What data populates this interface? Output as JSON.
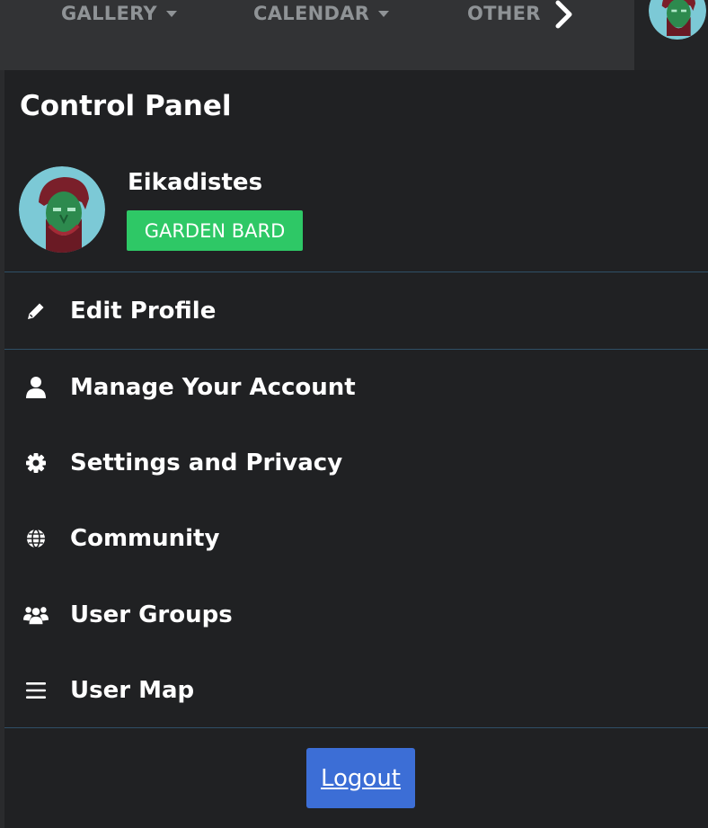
{
  "nav": {
    "items": [
      {
        "label": "GALLERY",
        "has_dropdown": true
      },
      {
        "label": "CALENDAR",
        "has_dropdown": true
      },
      {
        "label": "OTHER",
        "has_dropdown": false
      }
    ],
    "more_icon": "chevron-right-icon"
  },
  "panel": {
    "title": "Control Panel",
    "user": {
      "name": "Eikadistes",
      "badge": "GARDEN BARD",
      "badge_color": "#2ec866"
    },
    "menu": [
      {
        "label": "Edit Profile",
        "icon": "pencil-icon"
      },
      {
        "label": "Manage Your Account",
        "icon": "user-icon"
      },
      {
        "label": "Settings and Privacy",
        "icon": "gear-icon"
      },
      {
        "label": "Community",
        "icon": "globe-icon"
      },
      {
        "label": "User Groups",
        "icon": "users-icon"
      },
      {
        "label": "User Map",
        "icon": "list-icon"
      }
    ],
    "logout_label": "Logout"
  },
  "colors": {
    "panel_bg": "#202123",
    "nav_bg": "#323335",
    "accent_blue": "#3c6ed6",
    "divider": "#2f4f66"
  }
}
